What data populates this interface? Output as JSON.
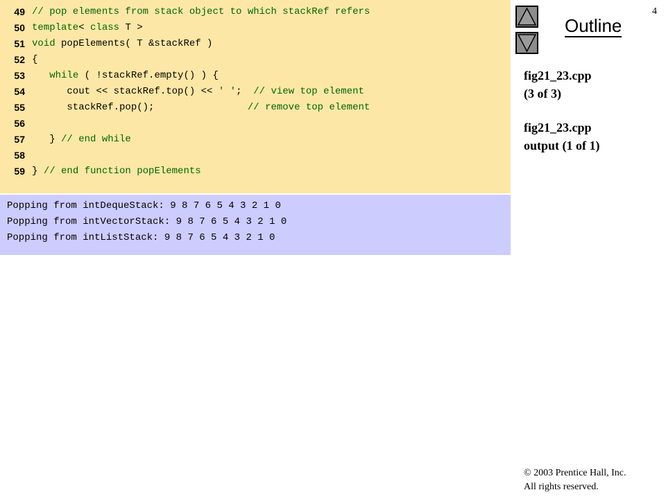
{
  "code": {
    "lines": [
      {
        "num": "49",
        "tokens": [
          {
            "t": "// pop elements from stack object to which stackRef refers",
            "c": "cm"
          }
        ]
      },
      {
        "num": "50",
        "tokens": [
          {
            "t": "template",
            "c": "kw"
          },
          {
            "t": "< ",
            "c": "pl"
          },
          {
            "t": "class",
            "c": "kw"
          },
          {
            "t": " T >",
            "c": "pl"
          }
        ]
      },
      {
        "num": "51",
        "tokens": [
          {
            "t": "void",
            "c": "kw"
          },
          {
            "t": " popElements( T &stackRef )",
            "c": "pl"
          }
        ]
      },
      {
        "num": "52",
        "tokens": [
          {
            "t": "{",
            "c": "pl"
          }
        ]
      },
      {
        "num": "53",
        "tokens": [
          {
            "t": "   ",
            "c": "pl"
          },
          {
            "t": "while",
            "c": "kw"
          },
          {
            "t": " ( !stackRef.empty() ) {",
            "c": "pl"
          }
        ]
      },
      {
        "num": "54",
        "tokens": [
          {
            "t": "      cout << stackRef.top() << ",
            "c": "pl"
          },
          {
            "t": "' '",
            "c": "st"
          },
          {
            "t": ";  ",
            "c": "pl"
          },
          {
            "t": "// view top element",
            "c": "cm"
          }
        ]
      },
      {
        "num": "55",
        "tokens": [
          {
            "t": "      stackRef.pop();                ",
            "c": "pl"
          },
          {
            "t": "// remove top element",
            "c": "cm"
          }
        ]
      },
      {
        "num": "56",
        "tokens": []
      },
      {
        "num": "57",
        "tokens": [
          {
            "t": "   } ",
            "c": "pl"
          },
          {
            "t": "// end while",
            "c": "cm"
          }
        ]
      },
      {
        "num": "58",
        "tokens": []
      },
      {
        "num": "59",
        "tokens": [
          {
            "t": "} ",
            "c": "pl"
          },
          {
            "t": "// end function popElements",
            "c": "cm"
          }
        ]
      }
    ]
  },
  "output": {
    "lines": [
      "Popping from intDequeStack: 9 8 7 6 5 4 3 2 1 0",
      "Popping from intVectorStack: 9 8 7 6 5 4 3 2 1 0",
      "Popping from intListStack: 9 8 7 6 5 4 3 2 1 0"
    ]
  },
  "sidebar": {
    "page_number": "4",
    "outline_title": "Outline",
    "nav_up_icon": "triangle-up-icon",
    "nav_down_icon": "triangle-down-icon",
    "file_label_1": "fig21_23.cpp",
    "file_label_2": "(3 of 3)",
    "file_label_3": "fig21_23.cpp",
    "file_label_4": "output (1 of 1)"
  },
  "footer": {
    "copyright_symbol": "©",
    "copyright_line": " 2003 Prentice Hall, Inc.",
    "rights_line": "All rights reserved."
  },
  "colors": {
    "code_background": "#fde7a6",
    "output_background": "#ccccff",
    "keyword": "#006600",
    "comment": "#006600",
    "nav_button": "#8c8c8c"
  }
}
